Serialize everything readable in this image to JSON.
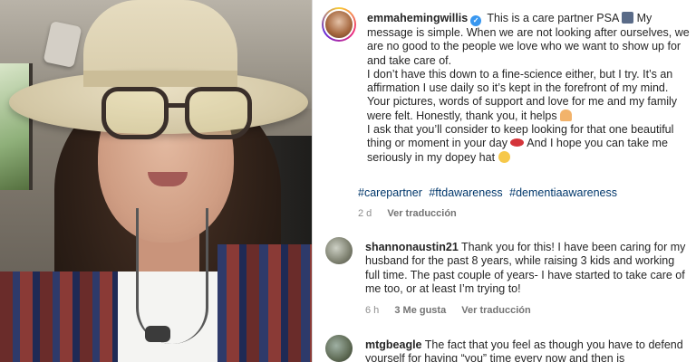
{
  "post": {
    "author": "emmahemingwillis",
    "caption_parts": [
      "This is a care partner PSA",
      "My message is simple. When we are not looking after ourselves, we are no good to the people we love who we want to show up for and take care of.",
      "I don’t have this down to a fine-science either, but I try. It’s an affirmation I use daily so it’s kept in the forefront of my mind. Your pictures, words of support and love for me and my family were felt. Honestly, thank you, it helps",
      "I ask that you’ll consider to keep looking for that one beautiful thing or moment in your day",
      "And I hope you can take me seriously in my dopey hat"
    ],
    "hashtags": [
      "#carepartner",
      "#ftdawareness",
      "#dementiaawareness"
    ],
    "age": "2 d",
    "see_translation": "Ver traducción"
  },
  "comments": [
    {
      "author": "shannonaustin21",
      "text": "Thank you for this! I have been caring for my husband for the past 8 years, while raising 3 kids and working full time. The past couple of years- I have started to take care of me too, or at least I’m trying to!",
      "age": "6 h",
      "likes": "3 Me gusta",
      "see_translation": "Ver traducción"
    },
    {
      "author": "mtgbeagle",
      "text": "The fact that you feel as though you have to defend yourself for having “you” time every now and then is"
    }
  ],
  "icons": {
    "verified": "verified-badge-icon",
    "speaker": "speaker-emoji",
    "pray": "praying-hands-emoji",
    "lips": "lips-emoji",
    "grin": "grinning-face-emoji"
  },
  "colors": {
    "link": "#00376b",
    "verified": "#3897f0",
    "muted": "#8e8e8e"
  }
}
